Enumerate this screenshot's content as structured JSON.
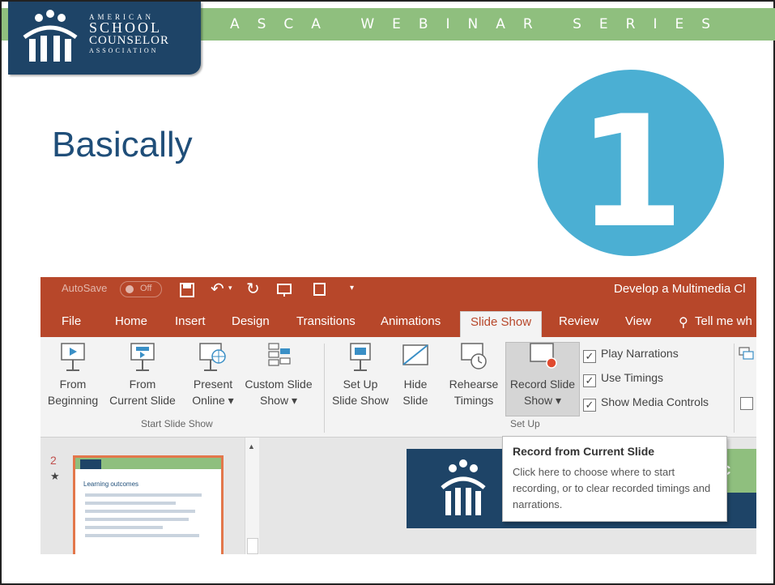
{
  "header": {
    "banner_text": "ASCA WEBINAR SERIES",
    "logo": {
      "line1": "AMERICAN",
      "line2": "SCHOOL",
      "line3": "COUNSELOR",
      "line4": "ASSOCIATION"
    }
  },
  "slide": {
    "title": "Basically",
    "step_number": "1",
    "number_color": "#4bafd3"
  },
  "powerpoint": {
    "titlebar": {
      "autosave": "AutoSave",
      "autosave_state": "Off",
      "doc_title": "Develop a Multimedia Cl"
    },
    "tabs": [
      "File",
      "Home",
      "Insert",
      "Design",
      "Transitions",
      "Animations",
      "Slide Show",
      "Review",
      "View",
      "Tell me wh"
    ],
    "active_tab": "Slide Show",
    "ribbon": {
      "start_group": {
        "label": "Start Slide Show",
        "buttons": [
          {
            "line1": "From",
            "line2": "Beginning"
          },
          {
            "line1": "From",
            "line2": "Current Slide"
          },
          {
            "line1": "Present",
            "line2": "Online ▾"
          },
          {
            "line1": "Custom Slide",
            "line2": "Show ▾"
          }
        ]
      },
      "setup_group": {
        "label": "Set Up",
        "buttons": [
          {
            "line1": "Set Up",
            "line2": "Slide Show"
          },
          {
            "line1": "Hide",
            "line2": "Slide"
          },
          {
            "line1": "Rehearse",
            "line2": "Timings"
          },
          {
            "line1": "Record Slide",
            "line2": "Show ▾"
          }
        ],
        "checkboxes": [
          {
            "label": "Play Narrations",
            "checked": true
          },
          {
            "label": "Use Timings",
            "checked": true
          },
          {
            "label": "Show Media Controls",
            "checked": true
          }
        ]
      }
    },
    "slide_pane": {
      "slide_number": "2",
      "star": "★",
      "thumb_title": "Learning outcomes"
    },
    "main_slide": {
      "green_letter": "C"
    },
    "tooltip": {
      "title": "Record from Current Slide",
      "body": "Click here to choose where to start recording, or to clear recorded timings and narrations."
    }
  }
}
